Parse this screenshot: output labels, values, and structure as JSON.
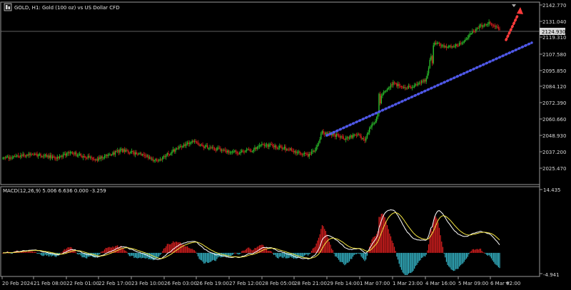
{
  "header": {
    "title": "GOLD, H1:  Gold (100 oz) vs US Dollar CFD",
    "icon": "chart-window-icon"
  },
  "macd_label": "MACD(12,26,9) 5.006 6.636 0.000 -3.259",
  "colors": {
    "background": "#000000",
    "frame": "#9a9a9a",
    "bull": "#2bbf2b",
    "bear": "#d81f1f",
    "trendline": "#4f58e8",
    "arrow": "#ff3b3b",
    "macd_line": "#ffffff",
    "signal_line": "#f4e542",
    "hist_pos": "#d81f1f",
    "hist_neg": "#35b6c8",
    "price_line": "#7f7f7f"
  },
  "chart_data": [
    {
      "type": "candlestick",
      "title": "GOLD, H1:  Gold (100 oz) vs US Dollar CFD",
      "ylim": [
        2015.0,
        2146.0
      ],
      "y_ticks": [
        "2142.770",
        "2131.040",
        "2119.310",
        "2107.580",
        "2095.850",
        "2084.120",
        "2072.390",
        "2060.660",
        "2048.930",
        "2037.200",
        "2025.470"
      ],
      "current_price": "2124.930",
      "x_ticks": [
        "20 Feb 2024",
        "21 Feb 08:00",
        "22 Feb 01:00",
        "22 Feb 17:00",
        "23 Feb 10:00",
        "26 Feb 03:00",
        "26 Feb 19:00",
        "27 Feb 12:00",
        "28 Feb 05:00",
        "28 Feb 21:00",
        "29 Feb 14:00",
        "1 Mar 07:00",
        "1 Mar 23:00",
        "4 Mar 16:00",
        "5 Mar 09:00",
        "6 Mar 02:00"
      ],
      "close_path": [
        [
          0,
          2028
        ],
        [
          10,
          2027
        ],
        [
          22,
          2030
        ],
        [
          34,
          2029
        ],
        [
          46,
          2027
        ],
        [
          58,
          2031
        ],
        [
          68,
          2028
        ],
        [
          80,
          2026
        ],
        [
          92,
          2030
        ],
        [
          100,
          2033
        ],
        [
          110,
          2031
        ],
        [
          120,
          2029
        ],
        [
          130,
          2024
        ],
        [
          140,
          2030
        ],
        [
          150,
          2036
        ],
        [
          160,
          2040
        ],
        [
          170,
          2036
        ],
        [
          180,
          2034
        ],
        [
          190,
          2032
        ],
        [
          200,
          2031
        ],
        [
          210,
          2033
        ],
        [
          220,
          2037
        ],
        [
          230,
          2036
        ],
        [
          240,
          2034
        ],
        [
          250,
          2031
        ],
        [
          258,
          2029
        ],
        [
          264,
          2033
        ],
        [
          270,
          2046
        ],
        [
          280,
          2045
        ],
        [
          290,
          2042
        ],
        [
          300,
          2045
        ],
        [
          306,
          2041
        ],
        [
          310,
          2050
        ],
        [
          316,
          2058
        ],
        [
          320,
          2075
        ],
        [
          326,
          2082
        ],
        [
          330,
          2085
        ],
        [
          336,
          2083
        ],
        [
          342,
          2082
        ],
        [
          350,
          2084
        ],
        [
          358,
          2088
        ],
        [
          364,
          2117
        ],
        [
          372,
          2115
        ],
        [
          380,
          2113
        ],
        [
          388,
          2117
        ],
        [
          396,
          2125
        ],
        [
          404,
          2130
        ],
        [
          410,
          2133
        ],
        [
          416,
          2130
        ],
        [
          420,
          2128
        ]
      ]
    },
    {
      "type": "macd",
      "label": "MACD(12,26,9) 5.006 6.636 0.000 -3.259",
      "ylim": [
        -4.941,
        14.435
      ],
      "y_ticks": [
        "14.435",
        "-4.941"
      ]
    }
  ]
}
